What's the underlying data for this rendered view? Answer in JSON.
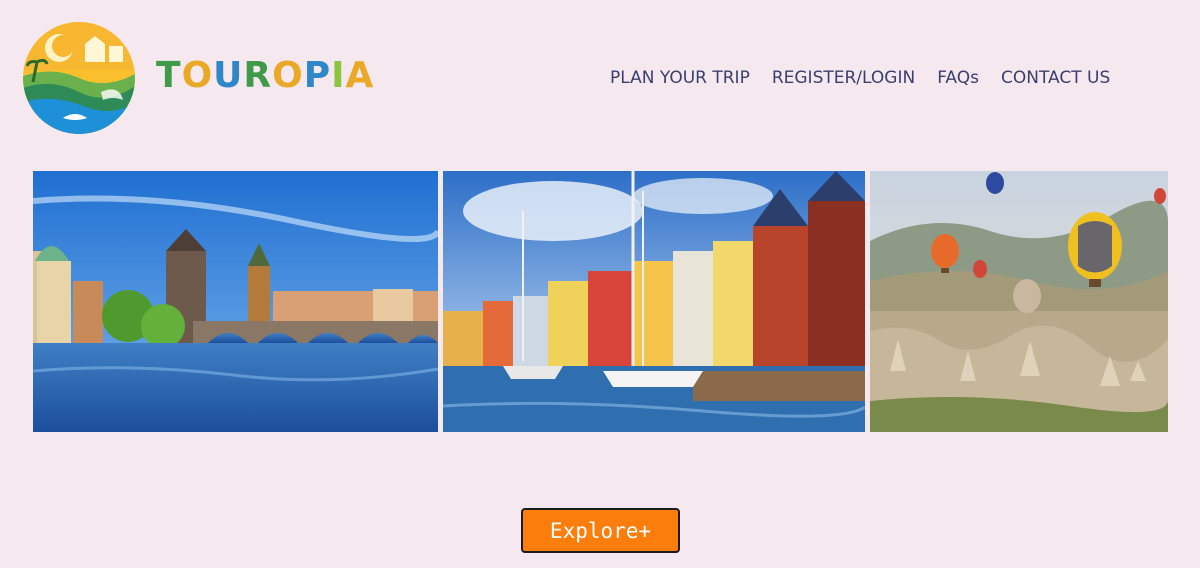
{
  "brand": {
    "name_letters": [
      "T",
      "O",
      "U",
      "R",
      "O",
      "P",
      "I",
      "A"
    ],
    "letter_colors": [
      "#3f9a4a",
      "#e9a826",
      "#2f87c8",
      "#3f9a4a",
      "#e9a826",
      "#2f87c8",
      "#8cc63f",
      "#e9a826"
    ],
    "logo_icon": "travel-logo-icon"
  },
  "nav": {
    "plan": "PLAN YOUR TRIP",
    "register": "REGISTER/LOGIN",
    "faqs": "FAQs",
    "contact": "CONTACT US"
  },
  "gallery": {
    "photos": [
      {
        "subject": "river-bridge-city-image"
      },
      {
        "subject": "harbour-colorful-houses-image"
      },
      {
        "subject": "hot-air-balloons-valley-image"
      }
    ]
  },
  "cta": {
    "explore": "Explore+"
  },
  "colors": {
    "background": "#f5e9ef",
    "nav_text": "#3b3f6e",
    "button": "#fb7d0c"
  }
}
